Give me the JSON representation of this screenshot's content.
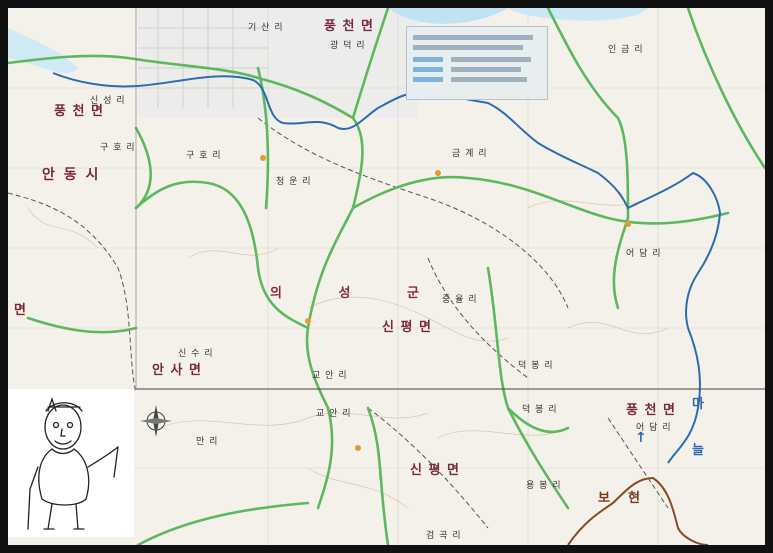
{
  "map": {
    "labels": {
      "pungcheon_top": "풍 천 면",
      "pungcheon_left": "풍 천 면",
      "pungcheon_right": "풍 천 면",
      "andong": "안 동 시",
      "county": "의 성 군",
      "sinpyeong_mid": "신 평 면",
      "sinpyeong_bottom": "신 평 면",
      "ansa": "안 사 면",
      "left_myeon": "면",
      "gisan": "기 산 리",
      "gwangdeok": "광 덕 리",
      "guho1": "구 호 리",
      "guho2": "구 호 리",
      "singseong": "신 성 리",
      "cheongun": "청 운 리",
      "geumgye": "금 계 리",
      "inkeum": "인 금 리",
      "adam": "어 담 리",
      "jungyul": "중 율 리",
      "sinsu": "신 수 리",
      "gyoan1": "교 안 리",
      "gyoan2": "교 안 리",
      "deokbong1": "덕 봉 리",
      "deokbong2": "덕 봉 리",
      "manri": "만 리",
      "yongbong": "용 봉 리",
      "geomgok": "검 곡 리",
      "eodam2": "어 담 리",
      "ma": "마",
      "neul": "늘",
      "bo": "보",
      "hyeon": "현"
    },
    "colors": {
      "route": "#2b6cb3",
      "road": "#5cb85c",
      "boundary_alt": "#8b4a24",
      "river": "#bfe3f2"
    }
  }
}
